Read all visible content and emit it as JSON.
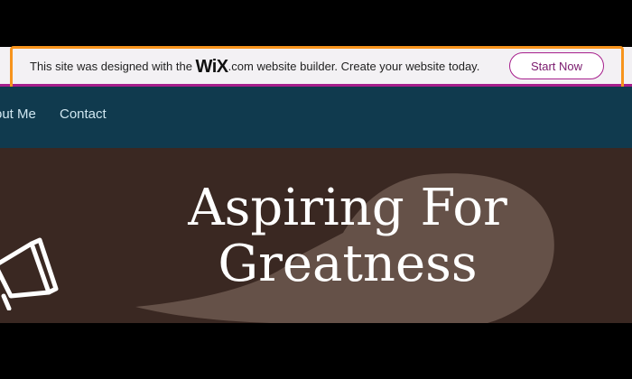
{
  "banner": {
    "text_before": "This site was designed with the ",
    "logo": "WiX",
    "text_after": ".com website builder. Create your website today.",
    "cta_label": "Start Now"
  },
  "nav": {
    "items": [
      {
        "label": "out Me"
      },
      {
        "label": "Contact"
      }
    ]
  },
  "hero": {
    "title_line1": "Aspiring For",
    "title_line2": "Greatness",
    "icon": "megaphone-icon"
  },
  "colors": {
    "highlight": "#f7941d",
    "brand_accent": "#a61e8c",
    "nav_bg": "#103a4e",
    "hero_bg": "#3a2822"
  }
}
